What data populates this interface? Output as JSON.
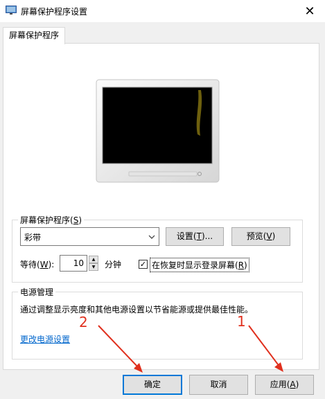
{
  "window": {
    "title": "屏幕保护程序设置",
    "icon": "display-settings-icon",
    "close_symbol": "✕"
  },
  "tabs": [
    {
      "label": "屏幕保护程序",
      "selected": true
    }
  ],
  "screensaver_group": {
    "label_text": "屏幕保护程序(",
    "label_key": "S",
    "label_end": ")",
    "selected_screensaver": "彩带",
    "settings_text": "设置(",
    "settings_key": "T",
    "settings_end": ")...",
    "preview_text": "预览(",
    "preview_key": "V",
    "preview_end": ")",
    "wait_text": "等待(",
    "wait_key": "W",
    "wait_end": "):",
    "wait_value": "10",
    "wait_unit": "分钟",
    "resume_checked": true,
    "resume_text": "在恢复时显示登录屏幕(",
    "resume_key": "R",
    "resume_end": ")"
  },
  "power_group": {
    "label": "电源管理",
    "description": "通过调整显示亮度和其他电源设置以节省能源或提供最佳性能。",
    "link": "更改电源设置"
  },
  "footer": {
    "ok": "确定",
    "cancel": "取消",
    "apply_text": "应用(",
    "apply_key": "A",
    "apply_end": ")"
  },
  "annotations": [
    {
      "number": "1",
      "target": "apply-button"
    },
    {
      "number": "2",
      "target": "ok-button"
    }
  ],
  "colors": {
    "accent": "#0078d7",
    "link": "#0066cc",
    "annotation": "#e0301e"
  }
}
